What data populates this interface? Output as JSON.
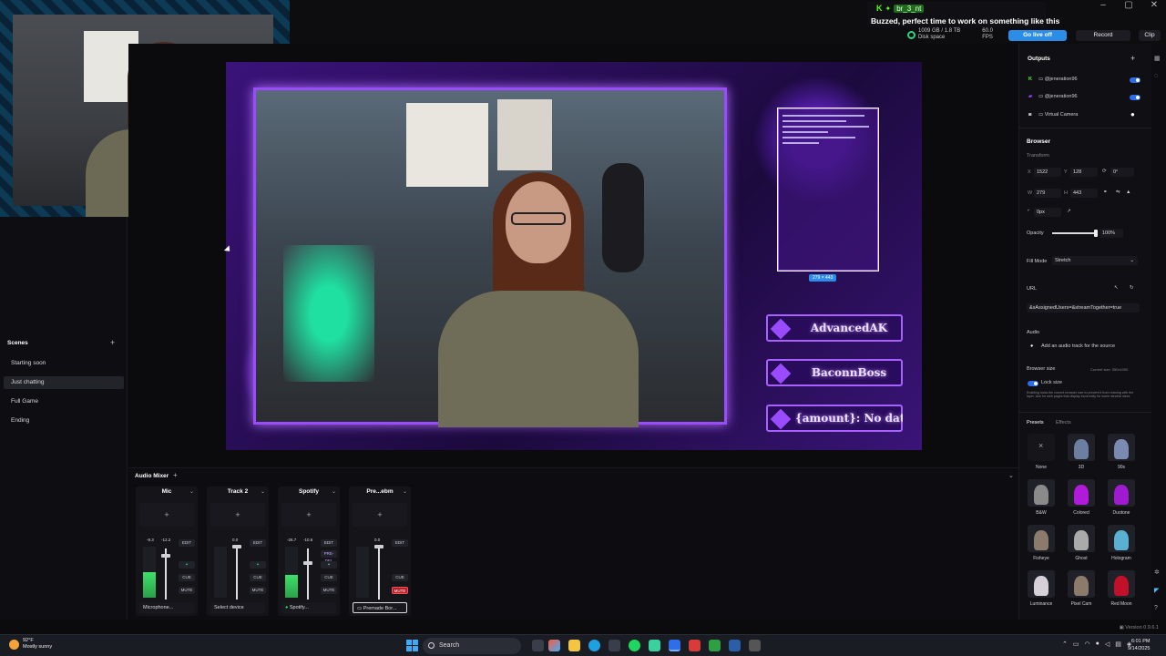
{
  "window": {
    "controls": [
      "–",
      "▢",
      "✕"
    ]
  },
  "notification": {
    "username": "br_3_nt",
    "message": "Buzzed, perfect time to work on something like this"
  },
  "stats": {
    "disk": "1009 GB / 1.8 TB",
    "disk_label": "Disk space",
    "fps": "60.0",
    "fps_label": "FPS"
  },
  "toolbar": {
    "go_live": "Go live off",
    "record": "Record",
    "clip": "Clip"
  },
  "scenes": {
    "title": "Scenes",
    "add": "+",
    "items": [
      "Starting soon",
      "Just chatting",
      "Full Game",
      "Ending"
    ],
    "active_index": 1
  },
  "preview": {
    "selection_size": "279 × 443",
    "alerts": [
      "AdvancedAK",
      "BaconnBoss",
      "{amount}: No data"
    ]
  },
  "mixer": {
    "title": "Audio Mixer",
    "add": "+",
    "tracks": [
      {
        "name": "Mic",
        "db_left": "-9.3",
        "db_right": "-12.2",
        "level": 0.5,
        "device": "Microphone...",
        "btn_a": "EDIT",
        "btn_b": "CUE",
        "btn_c": "MUTE",
        "muted": false
      },
      {
        "name": "Track 2",
        "db_left": "",
        "db_right": "0.0",
        "level": 0.0,
        "device": "Select device",
        "btn_a": "EDIT",
        "btn_b": "CUE",
        "btn_c": "MUTE",
        "muted": false
      },
      {
        "name": "Spotify",
        "db_left": "-26.7",
        "db_right": "-10.6",
        "level": 0.45,
        "device": "Spotify...",
        "btn_a": "EDIT",
        "btn_b": "CUE",
        "btn_c": "MUTE",
        "btn_extra": "PRE-DEL",
        "muted": false
      },
      {
        "name": "Pre...ebm",
        "db_left": "",
        "db_right": "0.0",
        "level": 0.0,
        "device": "Premade Bor...",
        "btn_a": "EDIT",
        "btn_b": "CUE",
        "btn_c": "MUTE",
        "muted": true
      }
    ]
  },
  "outputs": {
    "title": "Outputs",
    "add": "+",
    "items": [
      {
        "label": "@jeneration96",
        "platform": "kick",
        "on": true
      },
      {
        "label": "@jeneration96",
        "platform": "twitch",
        "on": true
      },
      {
        "label": "Virtual Camera",
        "platform": "camera",
        "on": false
      }
    ]
  },
  "properties": {
    "section": "Browser",
    "transform_label": "Transform",
    "x_label": "X",
    "x": "1522",
    "y_label": "Y",
    "y": "128",
    "rotation": "0°",
    "w_label": "W",
    "w": "279",
    "h_label": "H",
    "h": "443",
    "corner": "0px",
    "opacity_label": "Opacity",
    "opacity": "100%",
    "fill_mode_label": "Fill Mode",
    "fill_mode": "Stretch",
    "url_label": "URL",
    "url": "&sAssignedUsers=&streamTogether=true",
    "audio_label": "Audio",
    "audio_track": "Add an audio track for the source",
    "browser_size_label": "Browser size",
    "current_size": "Current size: 350x1000",
    "lock_size": "Lock size",
    "lock_desc": "Enabling locks the current browser size to prevent it from resizing with the layer. Use for web pages that display incorrectly for some window sizes."
  },
  "presets": {
    "tab_active": "Presets",
    "tab_inactive": "Effects",
    "items": [
      "None",
      "3D",
      "90s",
      "B&W",
      "Colored",
      "Duotone",
      "Fisheye",
      "Ghost",
      "Hologram",
      "Luminance",
      "Pixel Cam",
      "Red Moon"
    ]
  },
  "version": "Version 0.9.6.1",
  "taskbar": {
    "weather_temp": "92°F",
    "weather_desc": "Mostly sunny",
    "search": "Search",
    "time": "6:01 PM",
    "date": "9/14/2025"
  },
  "colors": {
    "accent": "#2c8de8",
    "kick": "#53fc18",
    "twitch": "#9146ff",
    "neon": "#9b4bff"
  }
}
